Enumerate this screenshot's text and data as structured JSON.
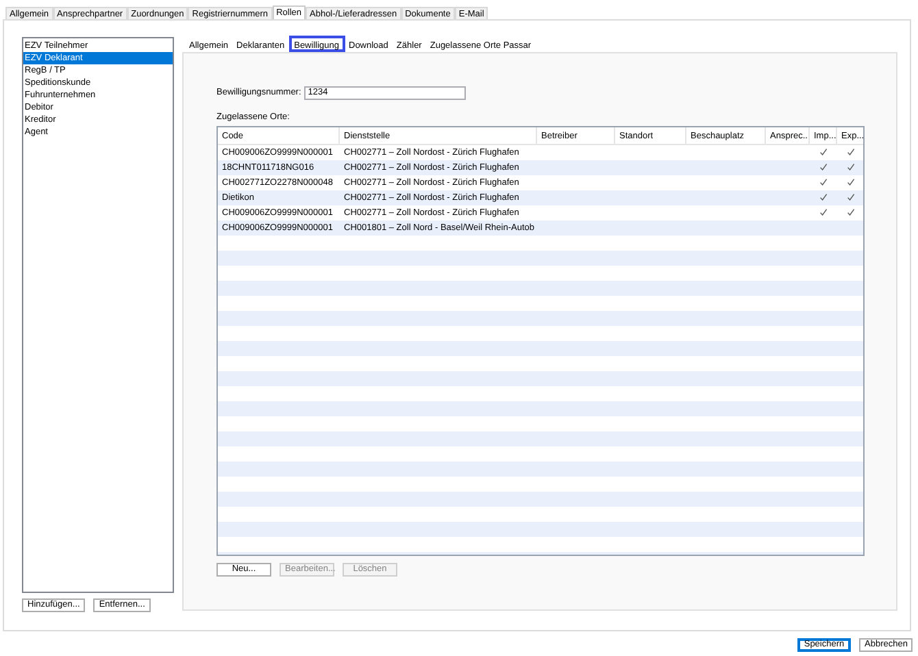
{
  "top_tabs": [
    {
      "label": "Allgemein",
      "selected": false
    },
    {
      "label": "Ansprechpartner",
      "selected": false
    },
    {
      "label": "Zuordnungen",
      "selected": false
    },
    {
      "label": "Registriernummern",
      "selected": false
    },
    {
      "label": "Rollen",
      "selected": true
    },
    {
      "label": "Abhol-/Lieferadressen",
      "selected": false
    },
    {
      "label": "Dokumente",
      "selected": false
    },
    {
      "label": "E-Mail",
      "selected": false
    }
  ],
  "roles": [
    {
      "label": "EZV Teilnehmer",
      "selected": false
    },
    {
      "label": "EZV Deklarant",
      "selected": true
    },
    {
      "label": "RegB / TP",
      "selected": false
    },
    {
      "label": "Speditionskunde",
      "selected": false
    },
    {
      "label": "Fuhrunternehmen",
      "selected": false
    },
    {
      "label": "Debitor",
      "selected": false
    },
    {
      "label": "Kreditor",
      "selected": false
    },
    {
      "label": "Agent",
      "selected": false
    }
  ],
  "role_buttons": [
    {
      "label": "Hinzufügen...",
      "disabled": false
    },
    {
      "label": "Entfernen...",
      "disabled": false
    }
  ],
  "inner_tabs": [
    {
      "label": "Allgemein",
      "selected": false
    },
    {
      "label": "Deklaranten",
      "selected": false
    },
    {
      "label": "Bewilligung",
      "selected": true
    },
    {
      "label": "Download",
      "selected": false
    },
    {
      "label": "Zähler",
      "selected": false
    },
    {
      "label": "Zugelassene Orte Passar",
      "selected": false
    }
  ],
  "permit_number": {
    "label": "Bewilligungsnummer:",
    "value": "1234"
  },
  "places": {
    "label": "Zugelassene Orte:",
    "columns": [
      "Code",
      "Dienststelle",
      "Betreiber",
      "Standort",
      "Beschauplatz",
      "Ansprec...",
      "Imp...",
      "Exp..."
    ],
    "rows": [
      {
        "code": "CH009006ZO9999N000001",
        "office": "CH002771 – Zoll Nordost - Zürich Flughafen",
        "import": true,
        "export": true
      },
      {
        "code": "18CHNT011718NG016",
        "office": "CH002771 – Zoll Nordost - Zürich Flughafen",
        "import": true,
        "export": true
      },
      {
        "code": "CH002771ZO2278N000048",
        "office": "CH002771 – Zoll Nordost - Zürich Flughafen",
        "import": true,
        "export": true
      },
      {
        "code": "Dietikon",
        "office": "CH002771 – Zoll Nordost - Zürich Flughafen",
        "import": true,
        "export": true
      },
      {
        "code": "CH009006ZO9999N000001",
        "office": "CH002771 – Zoll Nordost - Zürich Flughafen",
        "import": true,
        "export": true
      },
      {
        "code": "CH009006ZO9999N000001",
        "office": "CH001801 – Zoll Nord - Basel/Weil Rhein-Autob",
        "import": false,
        "export": false
      }
    ]
  },
  "place_buttons": [
    {
      "label": "Neu...",
      "disabled": false
    },
    {
      "label": "Bearbeiten...",
      "disabled": true
    },
    {
      "label": "Löschen",
      "disabled": true
    }
  ],
  "dialog_buttons": [
    {
      "label": "Speichern",
      "default": true
    },
    {
      "label": "Abbrechen",
      "default": false
    }
  ]
}
